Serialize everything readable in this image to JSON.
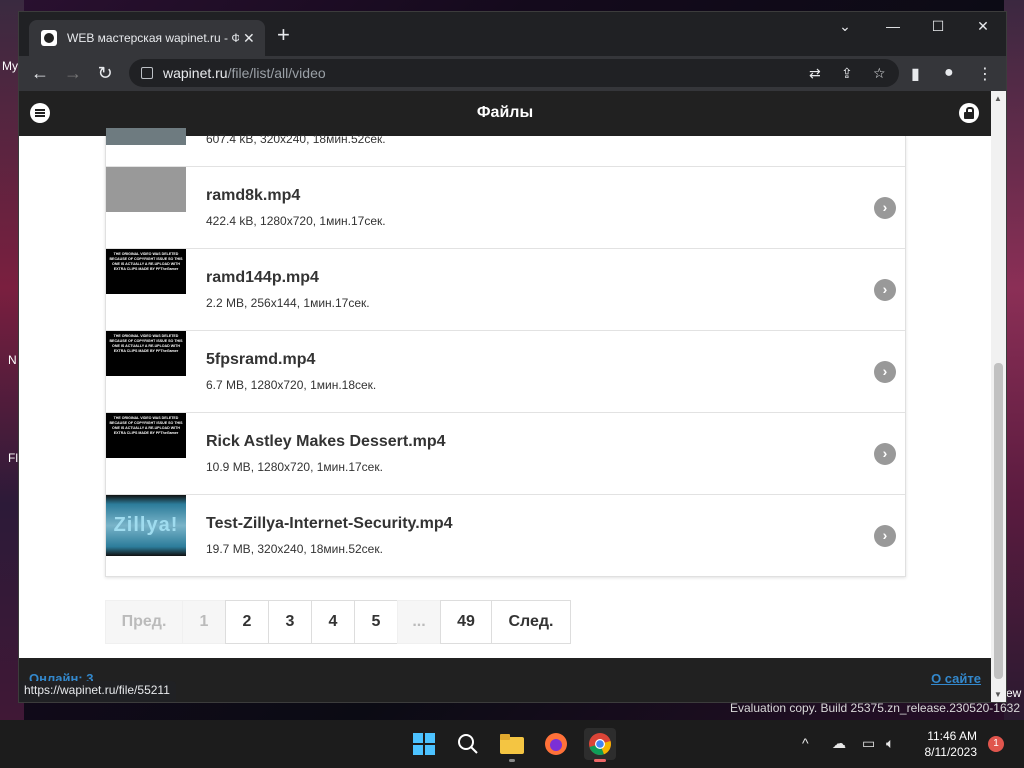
{
  "desktop": {
    "left_labels": [
      "My",
      "N",
      "Fl"
    ],
    "right_labels": [
      "ew"
    ]
  },
  "browser": {
    "tab_title": "WEB мастерская wapinet.ru - Фа",
    "tab_close": "✕",
    "new_tab": "+",
    "window_controls": {
      "dropdown": "⌄",
      "minimize": "—",
      "maximize": "☐",
      "close": "✕"
    },
    "nav": {
      "back": "←",
      "forward": "→",
      "reload": "↻"
    },
    "url_host": "wapinet.ru",
    "url_path": "/file/list/all/video",
    "status_url": "https://wapinet.ru/file/55211"
  },
  "site": {
    "title": "Файлы",
    "footer_online": "Онлайн: 3",
    "footer_about": "О сайте"
  },
  "files": [
    {
      "name": "",
      "meta": "607.4 kB, 320x240, 18мин.52сек.",
      "thumb": "grey-partial"
    },
    {
      "name": "ramd8k.mp4",
      "meta": "422.4 kB, 1280x720, 1мин.17сек.",
      "thumb": "grey"
    },
    {
      "name": "ramd144p.mp4",
      "meta": "2.2 MB, 256x144, 1мин.17сек.",
      "thumb": "black"
    },
    {
      "name": "5fpsramd.mp4",
      "meta": "6.7 MB, 1280x720, 1мин.18сек.",
      "thumb": "black"
    },
    {
      "name": "Rick Astley Makes Dessert.mp4",
      "meta": "10.9 MB, 1280x720, 1мин.17сек.",
      "thumb": "black"
    },
    {
      "name": "Test-Zillya-Internet-Security.mp4",
      "meta": "19.7 MB, 320x240, 18мин.52сек.",
      "thumb": "zillya"
    }
  ],
  "thumb_text": "THE ORIGINAL VIDEO WAS DELETED BECAUSE OF COPYRIGHT ISSUE SO THIS ONE IS ACTUALLY A RE-UPLOAD WITH EXTRA CLIPS MADE BY PFTheGamer",
  "zillya_text": "Zillya!",
  "pagination": {
    "prev": "Пред.",
    "pages": [
      "1",
      "2",
      "3",
      "4",
      "5",
      "...",
      "49"
    ],
    "next": "След."
  },
  "watermark": "Evaluation copy. Build 25375.zn_release.230520-1632",
  "taskbar": {
    "time": "11:46 AM",
    "date": "8/11/2023",
    "notifications": "1",
    "tray_chevron": "^"
  },
  "colors": {
    "header_bg": "#212121",
    "link": "#3388cc",
    "chrome_bg": "#202124",
    "notif": "#e0554d"
  }
}
